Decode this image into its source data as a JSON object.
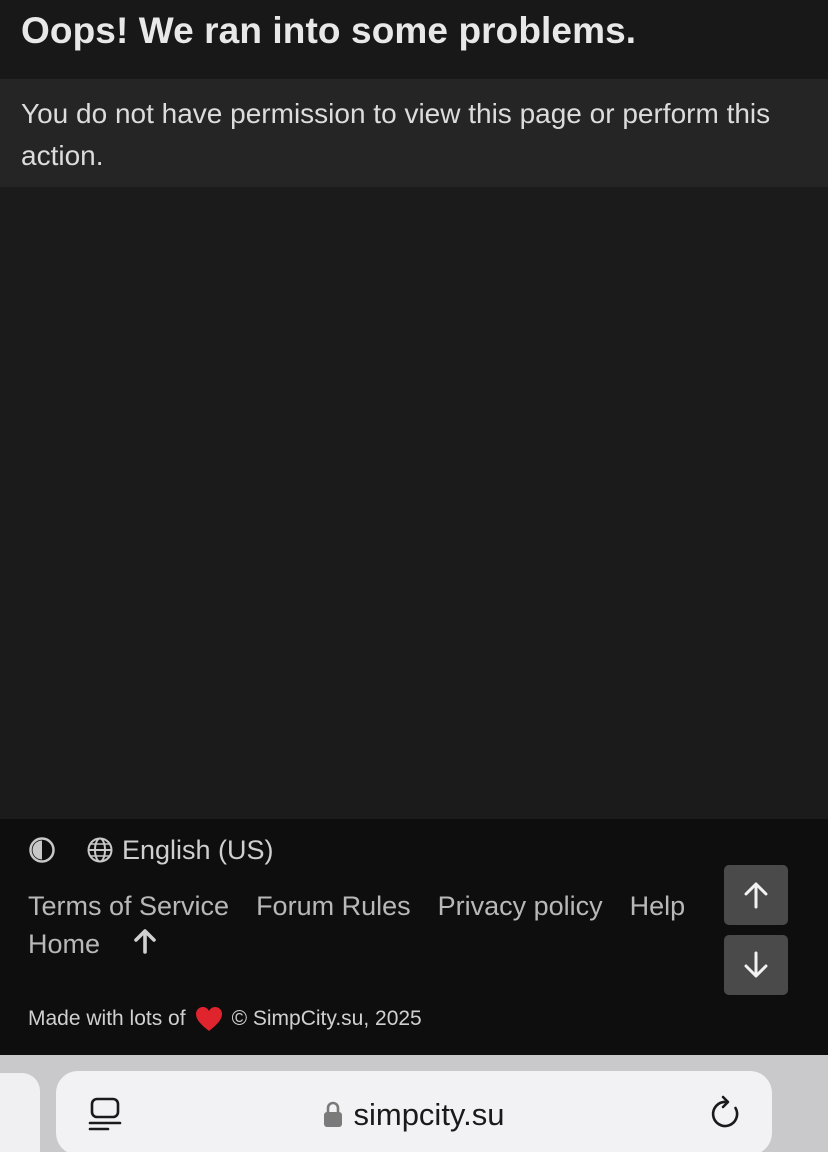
{
  "error": {
    "title": "Oops! We ran into some problems.",
    "message": "You do not have permission to view this page or perform this action."
  },
  "footer": {
    "style_toggle_icon": "contrast-icon",
    "language_icon": "globe-icon",
    "language": "English (US)",
    "links": {
      "terms": "Terms of Service",
      "rules": "Forum Rules",
      "privacy": "Privacy policy",
      "help": "Help",
      "home": "Home"
    },
    "up_icon": "arrow-up-icon",
    "copyright_prefix": "Made with lots of",
    "copyright_suffix": "© SimpCity.su, 2025",
    "heart_icon": "heart-icon"
  },
  "scroll_buttons": {
    "up_icon": "arrow-up-icon",
    "down_icon": "arrow-down-icon"
  },
  "browser": {
    "url": "simpcity.su",
    "tabs_icon": "tab-overview-icon",
    "lock_icon": "lock-icon",
    "reload_icon": "reload-icon"
  },
  "colors": {
    "background": "#1b1b1b",
    "message_box": "#252525",
    "footer": "#0e0e0e",
    "scroll_button": "#4a4a4a",
    "heart": "#e0242e"
  }
}
